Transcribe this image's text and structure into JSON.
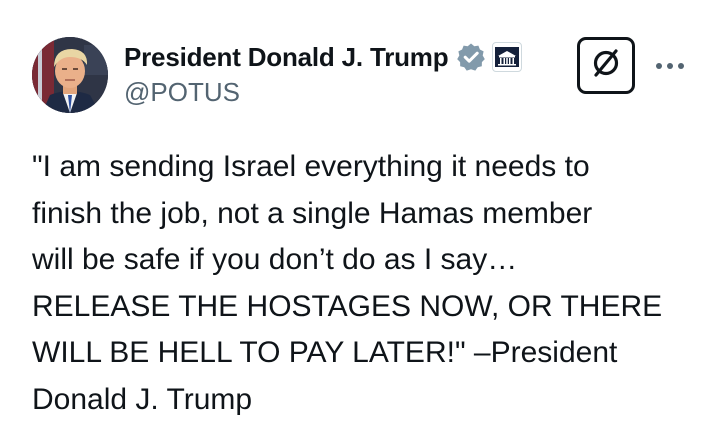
{
  "author": {
    "display_name": "President Donald J. Trump",
    "handle": "@POTUS",
    "verified_badge_color": "#829aab"
  },
  "icons": {
    "verified": "verified-badge-icon",
    "affiliation": "white-house-icon",
    "grok": "grok-icon",
    "more": "more-horizontal-icon"
  },
  "tweet": {
    "text": "\"I am sending Israel everything it needs to\nfinish the job, not a single Hamas member\nwill be safe if you don’t do as I say…\nRELEASE THE HOSTAGES NOW, OR THERE\nWILL BE HELL TO PAY LATER!\" –President\nDonald J. Trump"
  }
}
